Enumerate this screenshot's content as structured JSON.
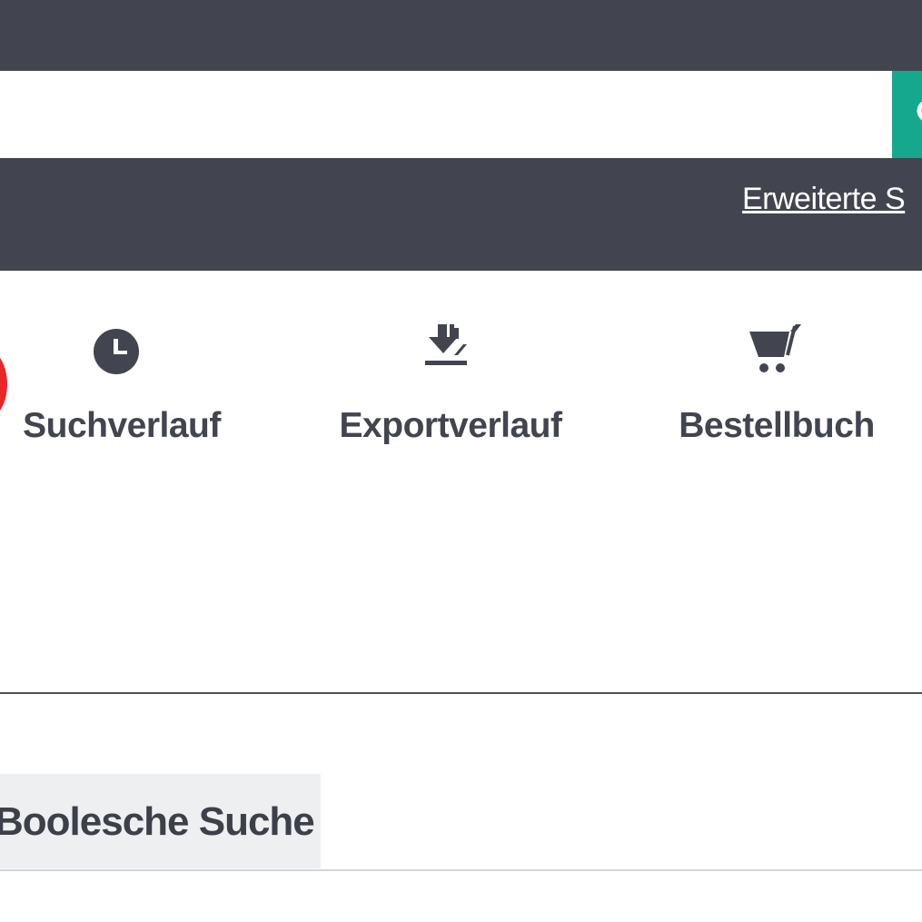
{
  "search": {
    "value": "",
    "placeholder": ""
  },
  "links": {
    "advanced_search": "Erweiterte S"
  },
  "tools": {
    "history": {
      "label": "Suchverlauf",
      "icon": "clock-icon"
    },
    "export": {
      "label": "Exportverlauf",
      "icon": "download-icon"
    },
    "order": {
      "label": "Bestellbuch",
      "icon": "cart-icon"
    }
  },
  "tabs": {
    "boolean": {
      "label": "Boolesche Suche"
    }
  },
  "colors": {
    "header_bg": "#42454f",
    "accent": "#15a88f",
    "text_dark": "#42454f",
    "tab_bg": "#eeeff1",
    "marker_red": "#e8262b"
  }
}
